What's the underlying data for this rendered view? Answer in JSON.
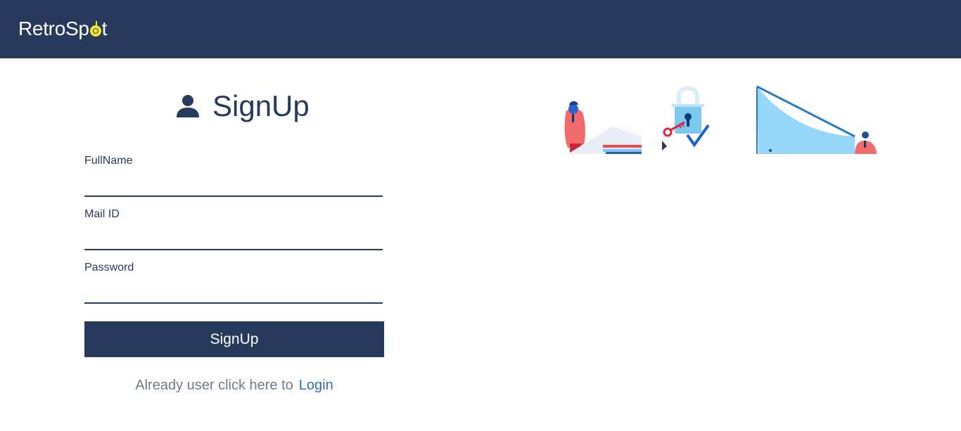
{
  "navbar": {
    "brand_prefix": "RetroSp",
    "brand_suffix": "t",
    "background": "#283a5b",
    "accent": "#f0eb2a"
  },
  "signup": {
    "title": "SignUp",
    "icon": "user-icon",
    "fields": [
      {
        "label": "FullName",
        "value": ""
      },
      {
        "label": "Mail ID",
        "value": ""
      },
      {
        "label": "Password",
        "value": ""
      }
    ],
    "submit_label": "SignUp",
    "login_prompt": "Already user click here to",
    "login_link": "Login"
  },
  "illustration": {
    "icon": "security-illustration-icon"
  }
}
